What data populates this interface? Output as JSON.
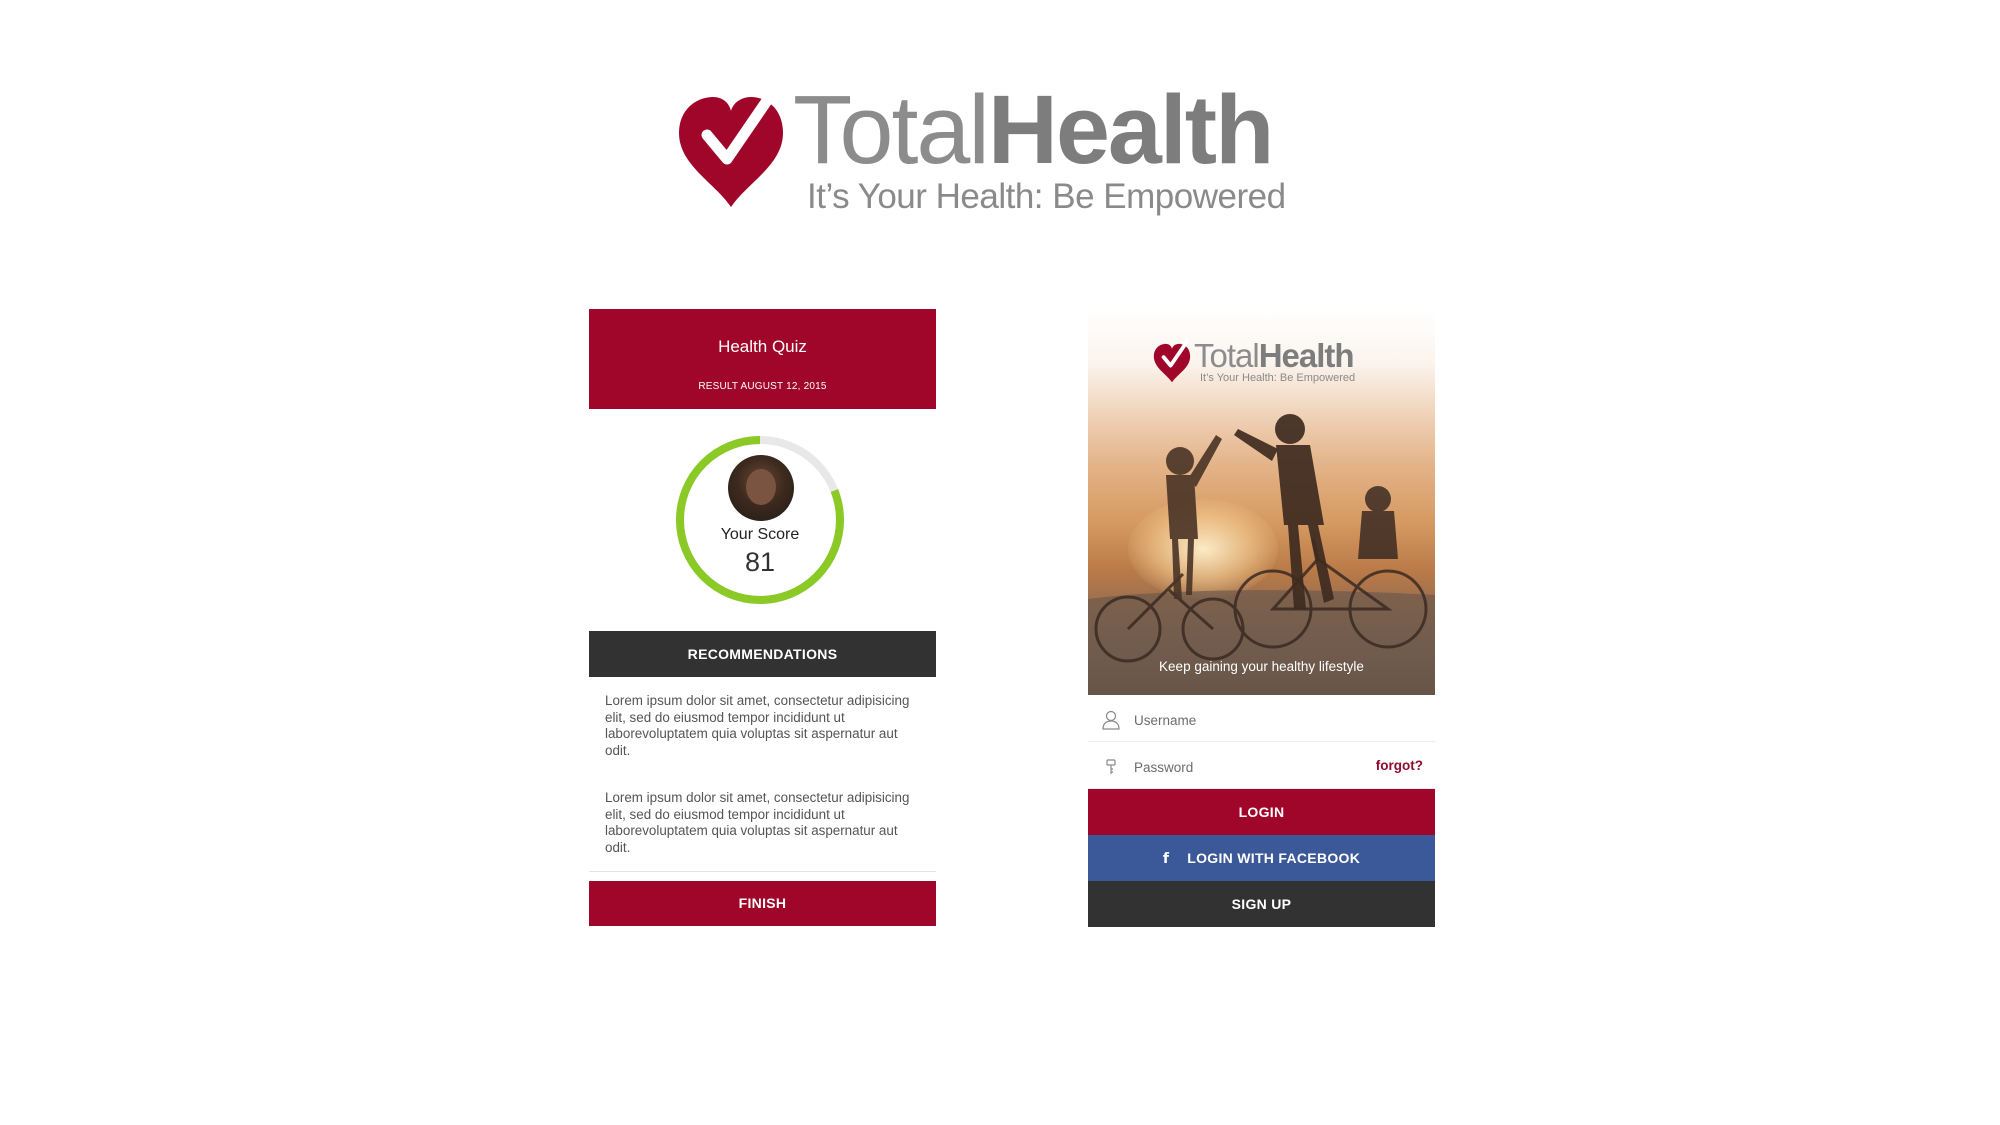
{
  "brand": {
    "name_light": "Total",
    "name_bold": "Health",
    "tagline": "It’s Your Health: Be Empowered",
    "color": "#a0062a"
  },
  "quiz": {
    "title": "Health Quiz",
    "result_date": "RESULT AUGUST 12, 2015",
    "score_label": "Your Score",
    "score_value": "81",
    "score_fraction": 0.81,
    "ring_color": "#8ac926",
    "recommendations_label": "RECOMMENDATIONS",
    "paragraphs": [
      "Lorem ipsum dolor sit amet, consectetur adipisicing elit, sed do eiusmod tempor incididunt ut laborevoluptatem quia voluptas sit aspernatur aut odit.",
      "Lorem ipsum dolor sit amet, consectetur adipisicing elit, sed do eiusmod tempor incididunt ut laborevoluptatem quia voluptas sit aspernatur aut odit."
    ],
    "finish_label": "FINISH"
  },
  "login": {
    "hero_caption": "Keep gaining your healthy lifestyle",
    "username_placeholder": "Username",
    "password_placeholder": "Password",
    "forgot_label": "forgot?",
    "login_label": "LOGIN",
    "facebook_label": "LOGIN WITH FACEBOOK",
    "facebook_icon": "facebook-f-icon",
    "signup_label": "SIGN UP",
    "facebook_color": "#3b5998",
    "dark_color": "#323232"
  }
}
